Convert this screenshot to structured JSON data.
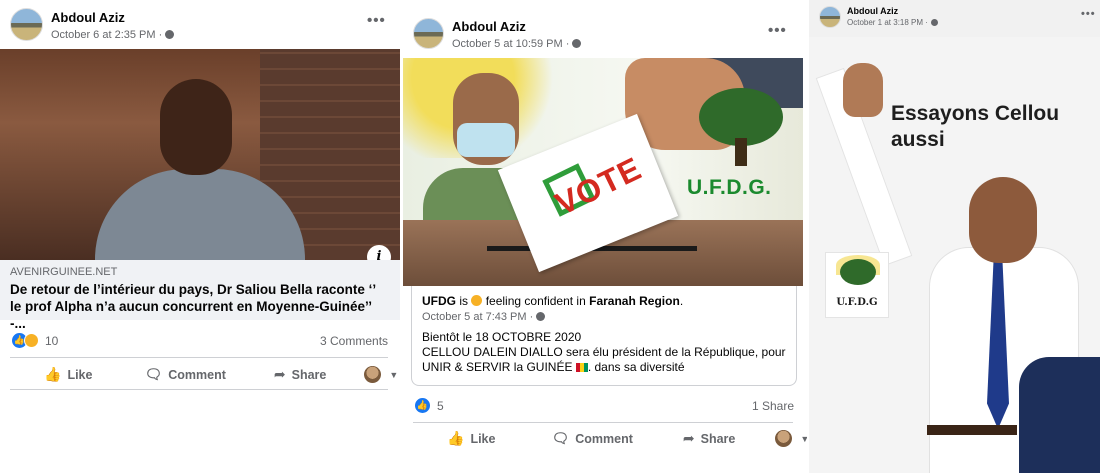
{
  "post1": {
    "author": "Abdoul Aziz",
    "date": "October 6 at 2:35 PM",
    "more_label": "•••",
    "link_domain": "AVENIRGUINEE.NET",
    "link_title": "De retour de l’intérieur du pays, Dr Saliou Bella raconte ‘’ le prof Alpha n’a aucun concurrent en Moyenne-Guinée’’ -...",
    "info_icon": "i",
    "reaction_count": "10",
    "comments_label": "3 Comments",
    "actions": {
      "like": "Like",
      "comment": "Comment",
      "share": "Share"
    }
  },
  "post2": {
    "author": "Abdoul Aziz",
    "date": "October 5 at 10:59 PM",
    "more_label": "•••",
    "photo_text": {
      "vote": "VOTE",
      "party": "U.F.D.G."
    },
    "shared": {
      "page": "UFDG",
      "is": "is",
      "feeling": "feeling confident in",
      "place": "Faranah Region",
      "date": "October 5 at 7:43 PM",
      "line1": "Bientôt le 18 OCTOBRE 2020",
      "line2": "CELLOU DALEIN DIALLO sera élu président de la République, pour",
      "line3a": "UNIR & SERVIR la GUINÉE",
      "line3b": ". dans sa diversité"
    },
    "reaction_count": "5",
    "shares_label": "1 Share",
    "actions": {
      "like": "Like",
      "comment": "Comment",
      "share": "Share"
    }
  },
  "post3": {
    "author": "Abdoul Aziz",
    "date": "October 1 at 3:18 PM",
    "more_label": "•••",
    "headline_1": "Essayons Cellou",
    "headline_2": "aussi",
    "logo_text": "U.F.D.G"
  },
  "colors": {
    "accent": "#1877f2",
    "muted": "#65676b",
    "divider": "#ced0d4",
    "party_green": "#1b8a2e",
    "vote_red": "#d42a20"
  }
}
